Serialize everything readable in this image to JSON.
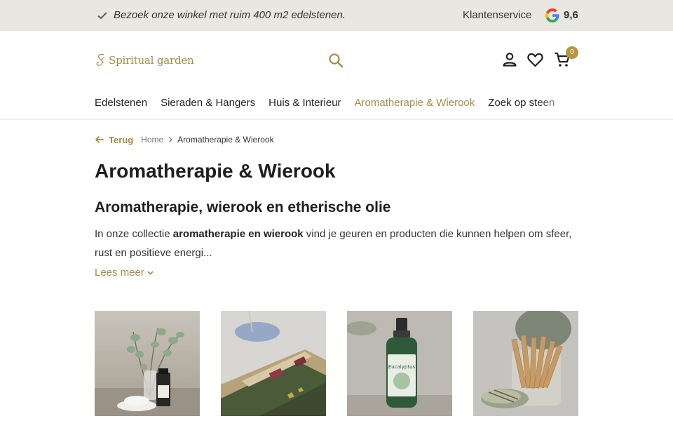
{
  "topbar": {
    "message": "Bezoek onze winkel met ruim 400 m2 edelstenen.",
    "service": "Klantenservice",
    "rating": "9,6"
  },
  "logo": {
    "text": "Spiritual garden"
  },
  "cart": {
    "count": "0"
  },
  "nav": {
    "items": [
      {
        "label": "Edelstenen"
      },
      {
        "label": "Sieraden & Hangers"
      },
      {
        "label": "Huis & Interieur"
      },
      {
        "label": "Aromatherapie & Wierook"
      },
      {
        "label": "Zoek op steen"
      }
    ]
  },
  "breadcrumb": {
    "back": "Terug",
    "home": "Home",
    "current": "Aromatherapie & Wierook"
  },
  "page": {
    "title": "Aromatherapie & Wierook",
    "subtitle": "Aromatherapie, wierook en etherische olie",
    "intro_before": "In onze collectie ",
    "intro_bold": "aromatherapie en wierook",
    "intro_after": " vind je geuren en producten die kunnen helpen om sfeer, rust en positieve energi...",
    "read_more": "Lees meer"
  },
  "products": {
    "spray_label": "Eucalyptus"
  },
  "colors": {
    "accent": "#a8894a",
    "badge": "#b8963e",
    "topbar_bg": "#e8e7e2"
  }
}
